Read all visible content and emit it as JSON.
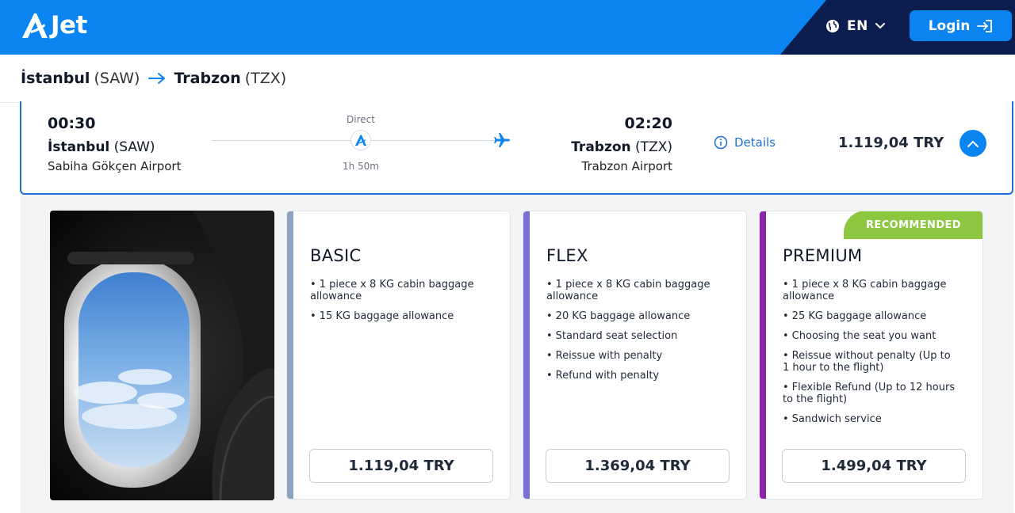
{
  "header": {
    "brand": "Jet",
    "language": "EN",
    "login_label": "Login",
    "colors": {
      "primary": "#0a84f0",
      "dark": "#0b1e4f"
    }
  },
  "route": {
    "from_city": "İstanbul",
    "from_code": "(SAW)",
    "to_city": "Trabzon",
    "to_code": "(TZX)"
  },
  "flight": {
    "departure_time": "00:30",
    "departure_city": "İstanbul",
    "departure_code": "(SAW)",
    "departure_airport": "Sabiha Gökçen Airport",
    "stops": "Direct",
    "duration": "1h 50m",
    "arrival_time": "02:20",
    "arrival_city": "Trabzon",
    "arrival_code": "(TZX)",
    "arrival_airport": "Trabzon Airport",
    "details_label": "Details",
    "price": "1.119,04 TRY"
  },
  "fares": [
    {
      "name": "BASIC",
      "stripe_color": "#8ea3bf",
      "features": [
        "1 piece x 8 KG cabin baggage allowance",
        "15 KG baggage allowance"
      ],
      "price": "1.119,04 TRY"
    },
    {
      "name": "FLEX",
      "stripe_color": "#7b6fd6",
      "features": [
        "1 piece x 8 KG cabin baggage allowance",
        "20 KG baggage allowance",
        "Standard seat selection",
        "Reissue with penalty",
        "Refund with penalty"
      ],
      "price": "1.369,04 TRY"
    },
    {
      "name": "PREMIUM",
      "stripe_color": "#8e24aa",
      "badge": "RECOMMENDED",
      "features": [
        "1 piece x 8 KG cabin baggage allowance",
        "25 KG baggage allowance",
        "Choosing the seat you want",
        "Reissue without penalty (Up to 1 hour to the flight)",
        "Flexible Refund (Up to 12 hours to the flight)",
        "Sandwich service"
      ],
      "price": "1.499,04 TRY"
    }
  ]
}
